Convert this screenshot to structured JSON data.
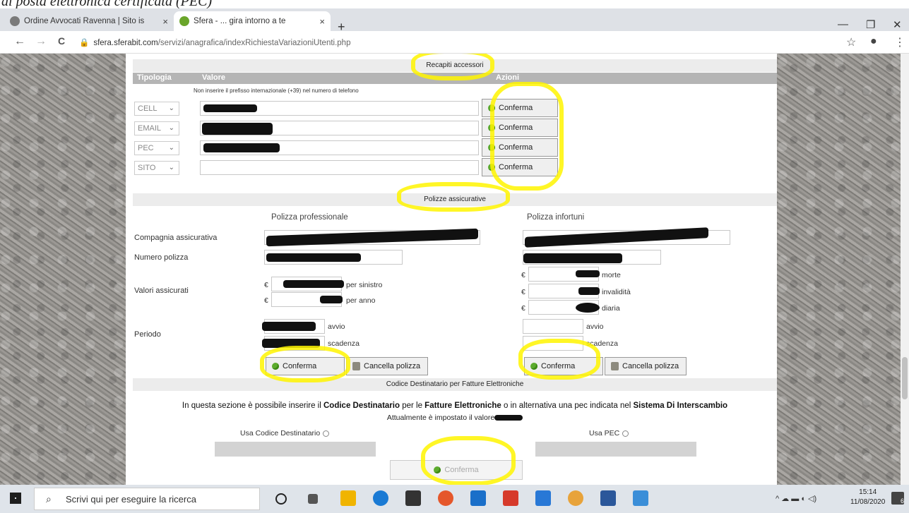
{
  "caption": "di posta elettronica certificata (PEC)",
  "browser": {
    "tabs": [
      {
        "title": "Ordine Avvocati Ravenna | Sito is",
        "active": false
      },
      {
        "title": "Sfera - ... gira intorno a te",
        "active": true
      }
    ],
    "close_glyph": "×",
    "new_tab_glyph": "+",
    "url_host": "sfera.sferabit.com",
    "url_path": "/servizi/anagrafica/indexRichiestaVariazioniUtenti.php",
    "window": {
      "minimize": "—",
      "maximize": "❐",
      "close": "✕"
    },
    "nav": {
      "back": "←",
      "forward": "→",
      "reload": "C"
    },
    "toolbar": {
      "star": "☆",
      "profile": "●",
      "menu": "⋮"
    }
  },
  "recapiti": {
    "section_title": "Recapiti accessori",
    "col_tipologia": "Tipologia",
    "col_valore": "Valore",
    "col_azioni": "Azioni",
    "hint": "Non inserire il prefisso internazionale (+39) nel numero di telefono",
    "rows": [
      {
        "type": "CELL",
        "button": "Conferma",
        "redacted": true
      },
      {
        "type": "EMAIL",
        "button": "Conferma",
        "redacted": true
      },
      {
        "type": "PEC",
        "button": "Conferma",
        "redacted": true
      },
      {
        "type": "SITO",
        "button": "Conferma",
        "redacted": false
      }
    ]
  },
  "polizze": {
    "section_title": "Polizze assicurative",
    "col_professionale": "Polizza professionale",
    "col_infortuni": "Polizza infortuni",
    "label_compagnia": "Compagnia assicurativa",
    "label_numero": "Numero polizza",
    "label_valori": "Valori assicurati",
    "label_periodo": "Periodo",
    "currency": "€",
    "prof_values": [
      "per sinistro",
      "per anno"
    ],
    "inf_values": [
      "morte",
      "invalidità",
      "diaria"
    ],
    "avvio": "avvio",
    "scadenza": "scadenza",
    "btn_conferma": "Conferma",
    "btn_cancella": "Cancella polizza"
  },
  "codice": {
    "section_title": "Codice Destinatario per Fatture Elettroniche",
    "info_prefix": "In questa sezione è possibile inserire il ",
    "info_b1": "Codice Destinatario",
    "info_mid1": " per le ",
    "info_b2": "Fatture Elettroniche",
    "info_mid2": " o in alternativa una pec indicata nel ",
    "info_b3": "Sistema Di Interscambio",
    "current": "Attualmente è impostato il valore",
    "use_codice": "Usa Codice Destinatario",
    "use_pec": "Usa PEC",
    "btn_conferma": "Conferma"
  },
  "taskbar": {
    "search_placeholder": "Scrivi qui per eseguire la ricerca",
    "time": "15:14",
    "date": "11/08/2020",
    "notif_count": "6"
  }
}
